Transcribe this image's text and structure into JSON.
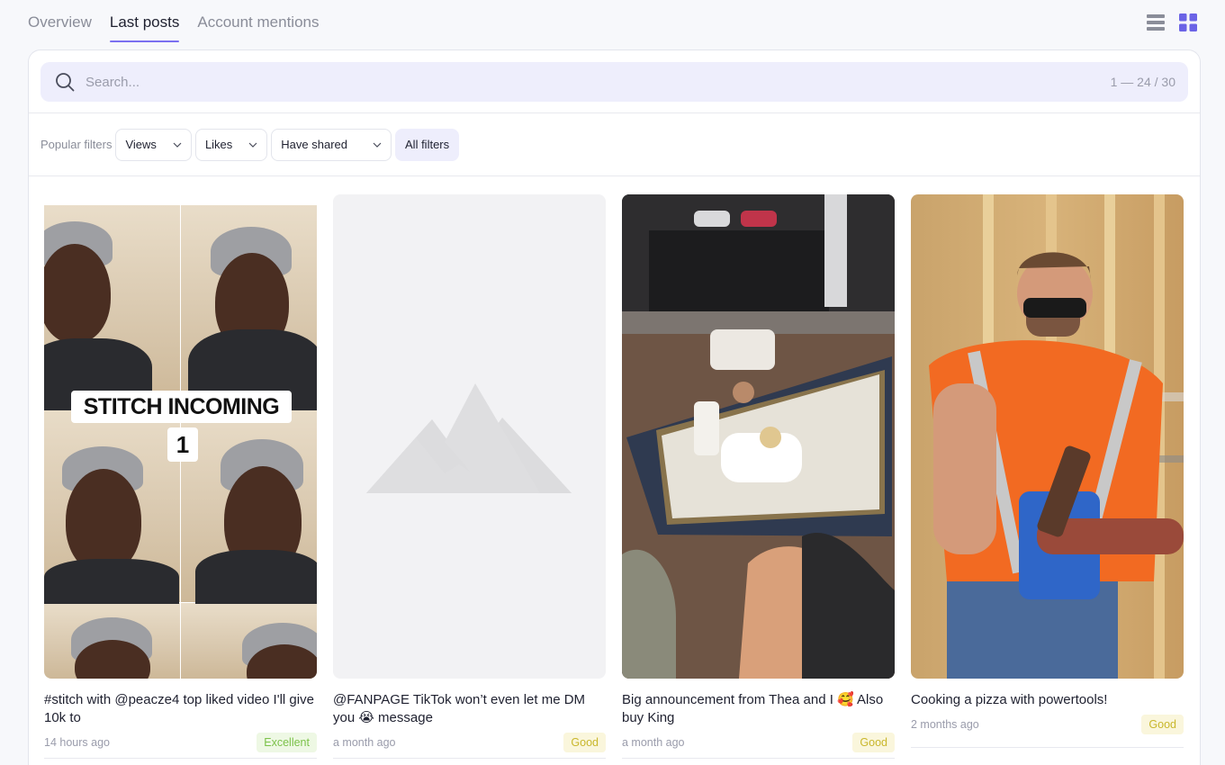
{
  "tabs": [
    {
      "label": "Overview"
    },
    {
      "label": "Last posts"
    },
    {
      "label": "Account mentions"
    }
  ],
  "active_tab": "Last posts",
  "view_toggle": {
    "list_icon": "list-icon",
    "grid_icon": "grid-icon",
    "active": "grid"
  },
  "search": {
    "placeholder": "Search...",
    "value": "",
    "pager": "1 — 24 / 30"
  },
  "filters": {
    "label": "Popular filters",
    "chips": [
      {
        "label": "Views"
      },
      {
        "label": "Likes"
      },
      {
        "label": "Have shared"
      }
    ],
    "all_filters_label": "All filters"
  },
  "posts": [
    {
      "thumb_text": "STITCH INCOMING",
      "thumb_number": "1",
      "caption": "#stitch with @peacze4 top liked video I'll give 10k to",
      "time": "14 hours ago",
      "badge": "Excellent"
    },
    {
      "caption": "@FANPAGE TikTok won’t even let me DM you 😭 message",
      "time": "a month ago",
      "badge": "Good"
    },
    {
      "caption": "Big announcement from Thea and I 🥰 Also buy King",
      "time": "a month ago",
      "badge": "Good"
    },
    {
      "caption": "Cooking a pizza with powertools!",
      "time": "2 months ago",
      "badge": "Good"
    }
  ],
  "colors": {
    "accent": "#7b6ff0",
    "search_bg": "#eeeefc",
    "excellent": "#7cc24a",
    "good": "#c9b72c"
  }
}
